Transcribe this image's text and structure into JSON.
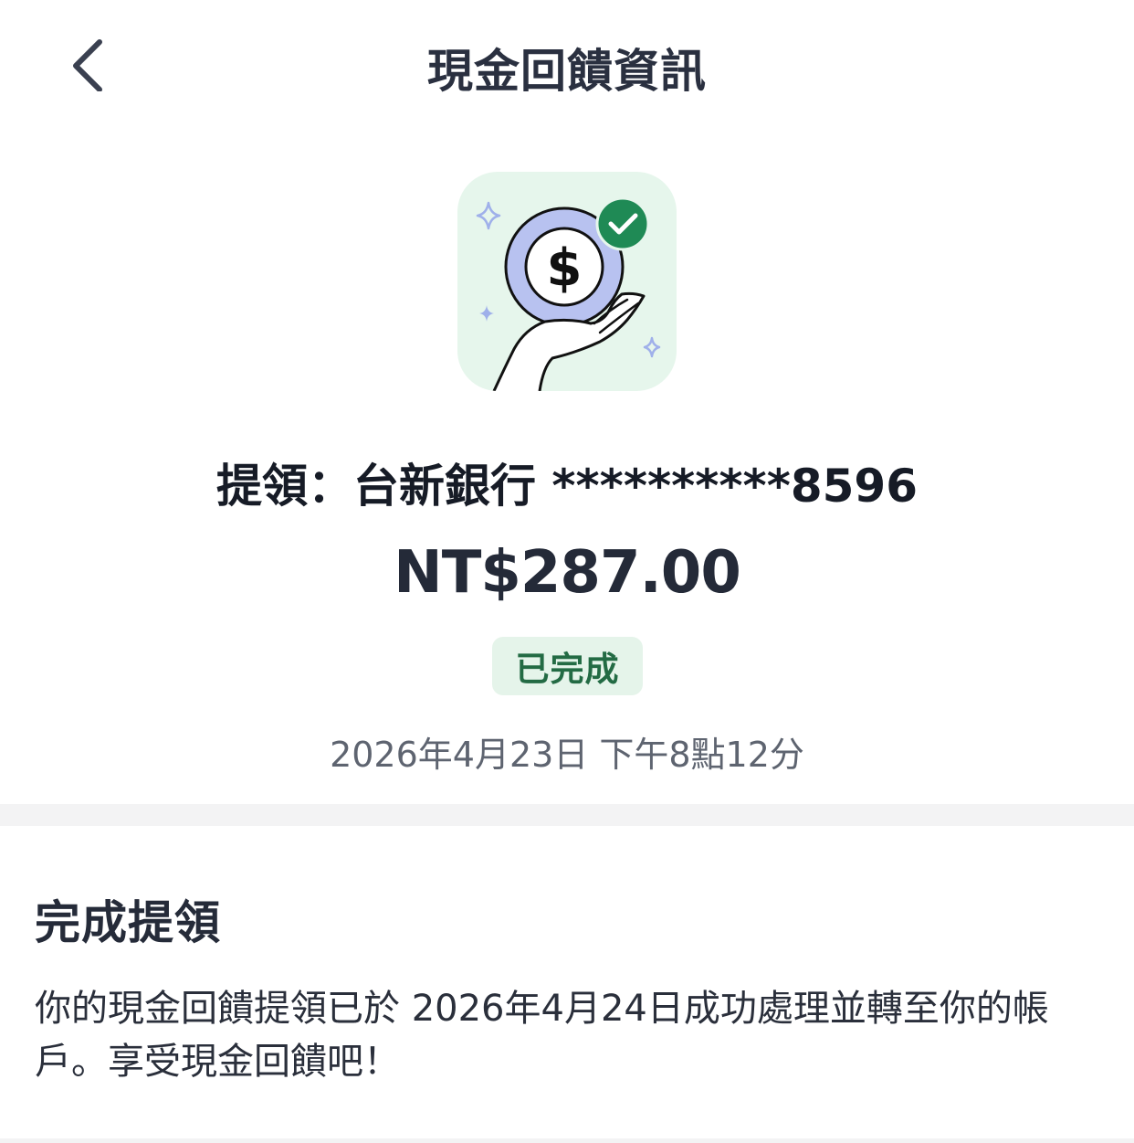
{
  "header": {
    "title": "現金回饋資訊",
    "back_icon": "chevron-left-icon"
  },
  "illustration": {
    "icon": "cash-received-icon",
    "colors": {
      "background": "#e6f6ec",
      "coin_ring": "#b8c2f0",
      "check": "#1f8a55",
      "sparkle": "#9fb0ea"
    }
  },
  "summary": {
    "withdraw_text": "提領：台新銀行 **********8596",
    "amount": "NT$287.00",
    "status": "已完成",
    "timestamp": "2026年4月23日 下午8點12分"
  },
  "section": {
    "title": "完成提領",
    "body": "你的現金回饋提領已於 2026年4月24日成功處理並轉至你的帳戶。享受現金回饋吧！"
  }
}
